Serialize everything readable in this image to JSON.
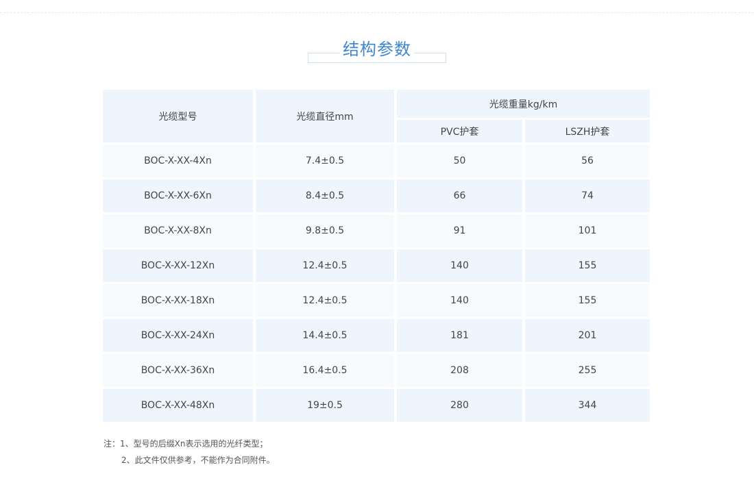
{
  "section_title": "结构参数",
  "table": {
    "headers": {
      "model": "光缆型号",
      "diameter": "光缆直径mm",
      "weight_group": "光缆重量kg/km",
      "pvc": "PVC护套",
      "lszh": "LSZH护套"
    },
    "rows": [
      {
        "model": "BOC-X-XX-4Xn",
        "diameter": "7.4±0.5",
        "pvc": "50",
        "lszh": "56"
      },
      {
        "model": "BOC-X-XX-6Xn",
        "diameter": "8.4±0.5",
        "pvc": "66",
        "lszh": "74"
      },
      {
        "model": "BOC-X-XX-8Xn",
        "diameter": "9.8±0.5",
        "pvc": "91",
        "lszh": "101"
      },
      {
        "model": "BOC-X-XX-12Xn",
        "diameter": "12.4±0.5",
        "pvc": "140",
        "lszh": "155"
      },
      {
        "model": "BOC-X-XX-18Xn",
        "diameter": "12.4±0.5",
        "pvc": "140",
        "lszh": "155"
      },
      {
        "model": "BOC-X-XX-24Xn",
        "diameter": "14.4±0.5",
        "pvc": "181",
        "lszh": "201"
      },
      {
        "model": "BOC-X-XX-36Xn",
        "diameter": "16.4±0.5",
        "pvc": "208",
        "lszh": "255"
      },
      {
        "model": "BOC-X-XX-48Xn",
        "diameter": "19±0.5",
        "pvc": "280",
        "lszh": "344"
      }
    ]
  },
  "notes": {
    "line1": "注：1、型号的后缀Xn表示选用的光纤类型；",
    "line2": "2、此文件仅供参考，不能作为合同附件。"
  },
  "colors": {
    "title": "#3f86cf",
    "header_bg": "#eef5fc",
    "row_alt_bg": "#eef5fc",
    "row_bg": "#f8fbfe"
  }
}
